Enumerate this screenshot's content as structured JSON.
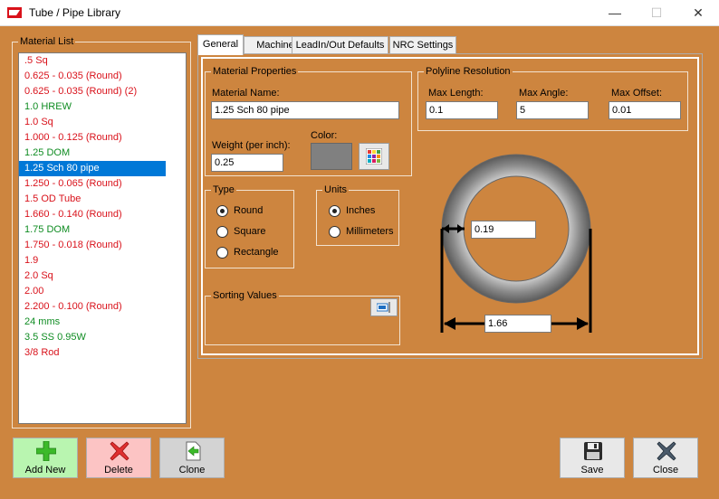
{
  "window": {
    "title": "Tube / Pipe Library"
  },
  "material_list": {
    "legend": "Material List",
    "items": [
      {
        "label": ".5 Sq",
        "color": "red"
      },
      {
        "label": "0.625 - 0.035 (Round)",
        "color": "red"
      },
      {
        "label": "0.625 - 0.035 (Round) (2)",
        "color": "red"
      },
      {
        "label": "1.0 HREW",
        "color": "green"
      },
      {
        "label": "1.0 Sq",
        "color": "red"
      },
      {
        "label": "1.000 - 0.125 (Round)",
        "color": "red"
      },
      {
        "label": "1.25 DOM",
        "color": "green"
      },
      {
        "label": "1.25 Sch 80 pipe",
        "color": "selected"
      },
      {
        "label": "1.250 - 0.065 (Round)",
        "color": "red"
      },
      {
        "label": "1.5 OD Tube",
        "color": "red"
      },
      {
        "label": "1.660 - 0.140 (Round)",
        "color": "red"
      },
      {
        "label": "1.75 DOM",
        "color": "green"
      },
      {
        "label": "1.750 - 0.018 (Round)",
        "color": "red"
      },
      {
        "label": "1.9",
        "color": "red"
      },
      {
        "label": "2.0 Sq",
        "color": "red"
      },
      {
        "label": "2.00",
        "color": "red"
      },
      {
        "label": "2.200 - 0.100 (Round)",
        "color": "red"
      },
      {
        "label": "24 mms",
        "color": "green"
      },
      {
        "label": "3.5 SS 0.95W",
        "color": "green"
      },
      {
        "label": "3/8 Rod",
        "color": "red"
      }
    ]
  },
  "tabs": [
    "General",
    "Machine",
    "LeadIn/Out Defaults",
    "NRC Settings"
  ],
  "material_properties": {
    "legend": "Material Properties",
    "name_label": "Material Name:",
    "name_value": "1.25 Sch 80 pipe",
    "weight_label": "Weight (per inch):",
    "weight_value": "0.25",
    "color_label": "Color:"
  },
  "polyline": {
    "legend": "Polyline Resolution",
    "max_length_label": "Max Length:",
    "max_length_value": "0.1",
    "max_angle_label": "Max Angle:",
    "max_angle_value": "5",
    "max_offset_label": "Max Offset:",
    "max_offset_value": "0.01"
  },
  "type_group": {
    "legend": "Type",
    "round": "Round",
    "square": "Square",
    "rectangle": "Rectangle",
    "selected": "Round"
  },
  "units_group": {
    "legend": "Units",
    "inches": "Inches",
    "millimeters": "Millimeters",
    "selected": "Inches"
  },
  "sorting": {
    "legend": "Sorting Values"
  },
  "diagram": {
    "wall_thickness": "0.19",
    "outer_diameter": "1.66"
  },
  "buttons": {
    "add_new": "Add New",
    "delete": "Delete",
    "clone": "Clone",
    "save": "Save",
    "close": "Close"
  },
  "colors": {
    "background": "#cd853f",
    "selection": "#0078d7",
    "item_red": "#d9121b",
    "item_green": "#0f8c22"
  }
}
